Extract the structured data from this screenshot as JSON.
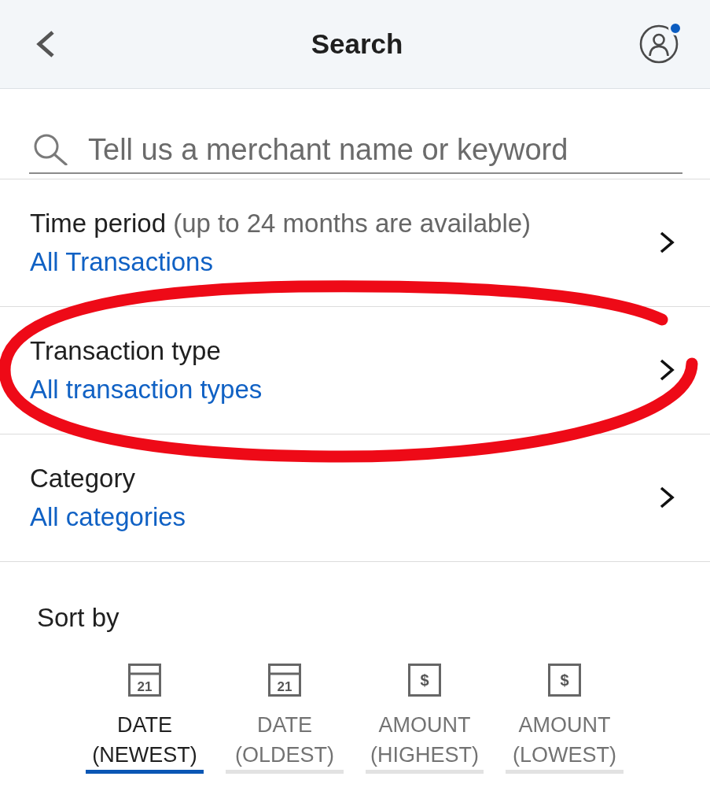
{
  "header": {
    "title": "Search",
    "notification": true
  },
  "search": {
    "placeholder": "Tell us a merchant name or keyword"
  },
  "filters": [
    {
      "label": "Time period",
      "note": "(up to 24 months are available)",
      "value": "All Transactions",
      "circled": false
    },
    {
      "label": "Transaction type",
      "value": "All transaction types",
      "circled": true
    },
    {
      "label": "Category",
      "value": "All categories",
      "circled": false
    }
  ],
  "sort": {
    "label": "Sort by",
    "options": [
      {
        "kind": "calendar",
        "icon_text": "21",
        "label": "DATE (NEWEST)",
        "selected": true
      },
      {
        "kind": "calendar",
        "icon_text": "21",
        "label": "DATE (OLDEST)",
        "selected": false
      },
      {
        "kind": "dollar",
        "icon_text": "$",
        "label": "AMOUNT (HIGHEST)",
        "selected": false
      },
      {
        "kind": "dollar",
        "icon_text": "$",
        "label": "AMOUNT (LOWEST)",
        "selected": false
      }
    ]
  }
}
